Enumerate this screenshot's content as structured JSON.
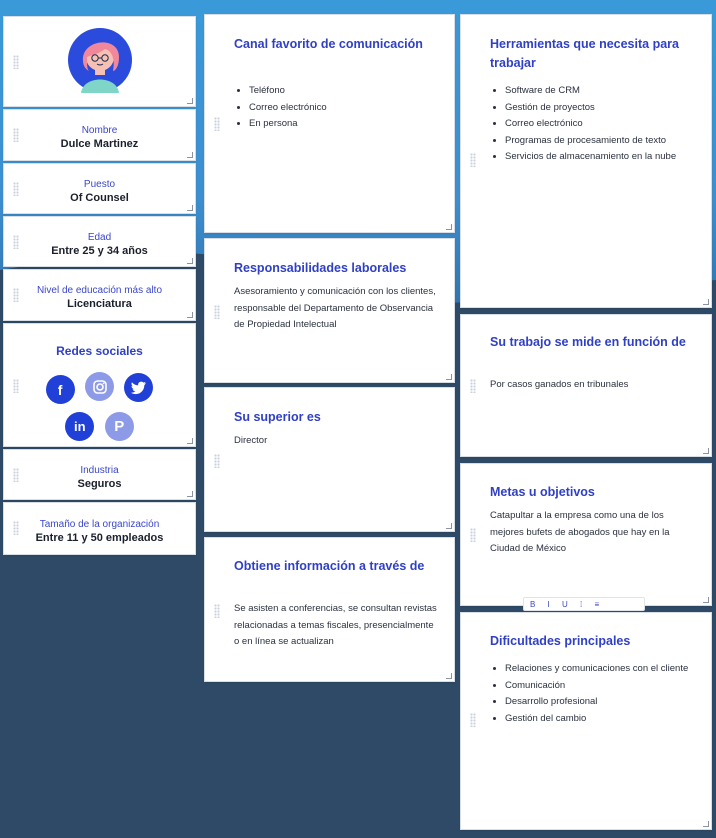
{
  "profile": {
    "avatar_alt": "avatar"
  },
  "left": [
    {
      "label": "Nombre",
      "value": "Dulce Martinez"
    },
    {
      "label": "Puesto",
      "value": "Of Counsel"
    },
    {
      "label": "Edad",
      "value": "Entre 25 y 34 años"
    },
    {
      "label": "Nivel de educación más alto",
      "value": "Licenciatura"
    }
  ],
  "social": {
    "title": "Redes sociales",
    "icons": [
      "facebook-icon",
      "instagram-icon",
      "twitter-icon",
      "linkedin-icon",
      "pinterest-icon"
    ],
    "colors": {
      "facebook": "#2040d8",
      "instagram": "#8d9ae8",
      "twitter": "#2040d8",
      "linkedin": "#2040d8",
      "pinterest": "#8d9ae8"
    }
  },
  "left_bottom": [
    {
      "label": "Industria",
      "value": "Seguros"
    },
    {
      "label": "Tamaño de la organización",
      "value": "Entre 11 y 50 empleados"
    }
  ],
  "cards": {
    "canal": {
      "title": "Canal favorito de comunicación",
      "items": [
        "Teléfono",
        "Correo electrónico",
        "En persona"
      ]
    },
    "responsabilidades": {
      "title": "Responsabilidades laborales",
      "text": "Asesoramiento y comunicación con los clientes, responsable del Departamento de Observancia de Propiedad Intelectual"
    },
    "superior": {
      "title": "Su superior es",
      "text": "Director"
    },
    "informacion": {
      "title": "Obtiene información a través de",
      "text": "Se asisten a conferencias, se consultan revistas relacionadas a temas fiscales, presencialmente o en línea se actualizan"
    },
    "herramientas": {
      "title": "Herramientas que necesita para trabajar",
      "items": [
        "Software de CRM",
        "Gestión de proyectos",
        "Correo electrónico",
        "Programas de procesamiento de texto",
        "Servicios de almacenamiento en la nube"
      ]
    },
    "trabajo": {
      "title": "Su trabajo se mide en función de",
      "text": "Por casos ganados en tribunales"
    },
    "metas": {
      "title": "Metas u objetivos",
      "text": "Catapultar a la empresa como una de los mejores bufets de abogados que hay en la Ciudad de México"
    },
    "dificultades": {
      "title": "Dificultades principales",
      "items": [
        "Relaciones y comunicaciones con el cliente",
        "Comunicación",
        "Desarrollo profesional",
        "Gestión del cambio"
      ]
    }
  },
  "toolbar": {
    "text": "B I U ⁞ ≡"
  },
  "colors": {
    "accent": "#3040c4",
    "bg_top": "#3a9ad9",
    "bg_bottom": "#2e4a66"
  }
}
